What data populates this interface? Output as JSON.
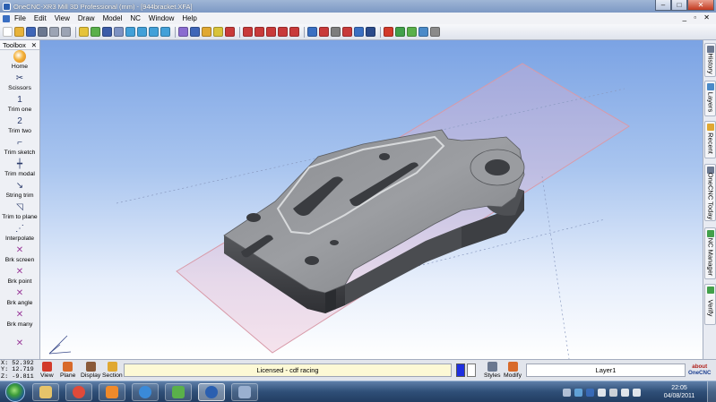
{
  "window": {
    "title": "OneCNC-XR3 Mill 3D Professional (mm) - [944bracket.XFA]",
    "buttons": [
      "–",
      "□",
      "✕"
    ]
  },
  "menubar": {
    "items": [
      "File",
      "Edit",
      "View",
      "Draw",
      "Model",
      "NC",
      "Window",
      "Help"
    ],
    "mdi_controls": "_ ▫ ✕"
  },
  "toolbar": {
    "buttons": [
      {
        "icon": "new-file-icon",
        "color": "#ffffff"
      },
      {
        "icon": "open-folder-icon",
        "color": "#e8b33a"
      },
      {
        "icon": "save-icon",
        "color": "#3f66b8"
      },
      {
        "icon": "print-icon",
        "color": "#6b7890"
      },
      {
        "icon": "undo-icon",
        "color": "#9ca4b4"
      },
      {
        "icon": "redo-icon",
        "color": "#9ca4b4"
      },
      {
        "icon": "view-icon",
        "color": "#e5c33a"
      },
      {
        "icon": "view-rotate-icon",
        "color": "#5ab04a"
      },
      {
        "icon": "pencil-icon",
        "color": "#3c5ca8"
      },
      {
        "icon": "zoom-window-icon",
        "color": "#7d92c2"
      },
      {
        "icon": "zoom-in-icon",
        "color": "#42a0d8"
      },
      {
        "icon": "zoom-out-icon",
        "color": "#42a0d8"
      },
      {
        "icon": "zoom-all-icon",
        "color": "#42a0d8"
      },
      {
        "icon": "zoom-prev-icon",
        "color": "#42a0d8"
      },
      {
        "icon": "shade-icon",
        "color": "#8a6cd0"
      },
      {
        "icon": "solid-icon",
        "color": "#3f66b8"
      },
      {
        "icon": "surface-icon",
        "color": "#e0a832"
      },
      {
        "icon": "wire-icon",
        "color": "#d8c33a"
      },
      {
        "icon": "snap-icon",
        "color": "#c83a3a"
      },
      {
        "icon": "snap-end-icon",
        "color": "#c83a3a"
      },
      {
        "icon": "snap-mid-icon",
        "color": "#c83a3a"
      },
      {
        "icon": "snap-center-icon",
        "color": "#c83a3a"
      },
      {
        "icon": "snap-int-icon",
        "color": "#c83a3a"
      },
      {
        "icon": "layer-grid-icon",
        "color": "#c83a3a"
      },
      {
        "icon": "layer-icon",
        "color": "#3a6fc2"
      },
      {
        "icon": "layer-stack-icon",
        "color": "#c83a3a"
      },
      {
        "icon": "grid-icon",
        "color": "#7d7d7d"
      },
      {
        "icon": "grid-red-icon",
        "color": "#c83a3a"
      },
      {
        "icon": "grid-blue-icon",
        "color": "#3a6fc2"
      },
      {
        "icon": "table-icon",
        "color": "#2a4a8a"
      },
      {
        "icon": "stop-icon",
        "color": "#d23a2a"
      },
      {
        "icon": "run-icon",
        "color": "#42a04a"
      },
      {
        "icon": "toolpath-icon",
        "color": "#5ab04a"
      },
      {
        "icon": "verify-icon",
        "color": "#4a8ac8"
      },
      {
        "icon": "more-icon",
        "color": "#8a8a8a"
      }
    ],
    "separators_after": [
      5,
      13,
      18,
      23,
      29
    ]
  },
  "toolbox": {
    "title": "Toolbox",
    "close": "✕",
    "tools": [
      {
        "label": "Home",
        "icon": "home-icon",
        "glyph": ""
      },
      {
        "label": "Scissors",
        "icon": "scissors-icon",
        "glyph": "✂"
      },
      {
        "label": "Trim one",
        "icon": "trim-one-icon",
        "glyph": "1"
      },
      {
        "label": "Trim two",
        "icon": "trim-two-icon",
        "glyph": "2"
      },
      {
        "label": "Trim sketch",
        "icon": "trim-sketch-icon",
        "glyph": "⌐"
      },
      {
        "label": "Trim modal",
        "icon": "trim-modal-icon",
        "glyph": "┿"
      },
      {
        "label": "String trim",
        "icon": "string-trim-icon",
        "glyph": "↘"
      },
      {
        "label": "Trim to plane",
        "icon": "trim-to-plane-icon",
        "glyph": "◹"
      },
      {
        "label": "Interpolate",
        "icon": "interpolate-icon",
        "glyph": "⋰"
      },
      {
        "label": "Brk screen",
        "icon": "break-screen-icon",
        "glyph": "✕"
      },
      {
        "label": "Brk point",
        "icon": "break-point-icon",
        "glyph": "✕"
      },
      {
        "label": "Brk angle",
        "icon": "break-angle-icon",
        "glyph": "✕"
      },
      {
        "label": "Brk many",
        "icon": "break-many-icon",
        "glyph": "✕"
      },
      {
        "label": "",
        "icon": "break-more-icon",
        "glyph": "✕"
      }
    ]
  },
  "right_tabs": [
    {
      "label": "History",
      "icon": "history-icon",
      "color": "#6b7890"
    },
    {
      "label": "Layers",
      "icon": "layers-icon",
      "color": "#4a8ac8"
    },
    {
      "label": "Recent",
      "icon": "recent-icon",
      "color": "#e0a832"
    },
    {
      "label": "OneCNC Today",
      "icon": "today-icon",
      "color": "#6b7890"
    },
    {
      "label": "NC Manager",
      "icon": "nc-manager-icon",
      "color": "#42a04a"
    },
    {
      "label": "Verify",
      "icon": "verify-tab-icon",
      "color": "#42a04a"
    }
  ],
  "status": {
    "coords": {
      "x": "X: 52.392",
      "y": "Y: 12.719",
      "z": "Z: -9.811"
    },
    "left_buttons": [
      {
        "label": "View",
        "icon": "view-cube-icon",
        "color": "#d23a2a"
      },
      {
        "label": "Plane",
        "icon": "plane-icon",
        "color": "#d86a2a"
      },
      {
        "label": "Display",
        "icon": "display-icon",
        "color": "#8a5a3a"
      },
      {
        "label": "Section",
        "icon": "section-icon",
        "color": "#e0a832"
      }
    ],
    "license_text": "Licensed - cdf racing",
    "current_color": "#1e2fe0",
    "right_buttons": [
      {
        "label": "Styles",
        "icon": "styles-icon",
        "color": "#6b7890"
      },
      {
        "label": "Modify",
        "icon": "modify-icon",
        "color": "#d86a2a"
      }
    ],
    "layer": "Layer1",
    "logo_top": "about",
    "logo_brand": "OneCNC"
  },
  "taskbar": {
    "apps": [
      {
        "icon": "explorer-icon",
        "color": "#e6c46a"
      },
      {
        "icon": "chrome-icon",
        "color": "#e04a3a"
      },
      {
        "icon": "media-player-icon",
        "color": "#f08a2a"
      },
      {
        "icon": "ie-icon",
        "color": "#3a8ad8"
      },
      {
        "icon": "app-tiles-icon",
        "color": "#5ab04a"
      },
      {
        "icon": "onecnc-icon",
        "color": "#2a5fb0"
      },
      {
        "icon": "design-icon",
        "color": "#9ab0d0"
      }
    ],
    "active_app": 5,
    "tray": [
      "network-icon",
      "help-icon",
      "bluetooth-icon",
      "arrow-up-icon",
      "flag-icon",
      "signal-icon",
      "volume-icon"
    ],
    "time": "22:05",
    "date": "04/08/2011"
  }
}
